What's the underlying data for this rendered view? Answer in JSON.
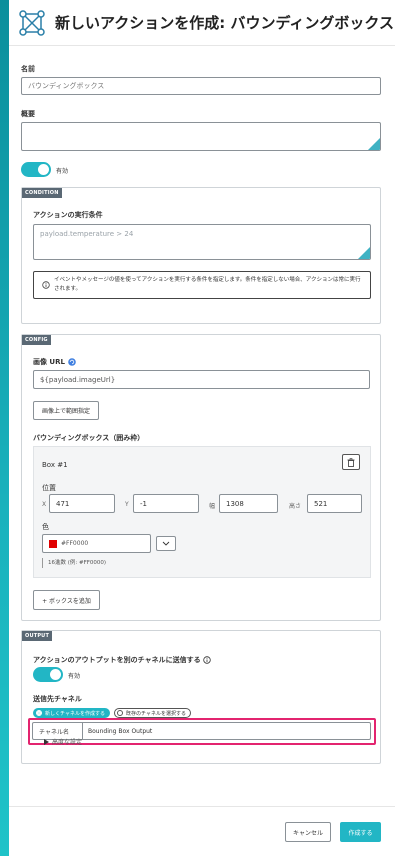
{
  "header": {
    "title": "新しいアクションを作成: バウンディングボックス",
    "icon": "bounding-box-icon"
  },
  "form": {
    "name_label": "名前",
    "name_value": "バウンディングボックス",
    "summary_label": "概要",
    "summary_value": "",
    "enabled_label": "有効",
    "enabled": true
  },
  "condition": {
    "tag": "CONDITION",
    "label": "アクションの実行条件",
    "placeholder": "payload.temperature > 24",
    "info_text": "イベントやメッセージの値を使ってアクションを実行する条件を指定します。条件を指定しない場合、アクションは常に実行されます。"
  },
  "config": {
    "tag": "CONFIG",
    "image_url_label": "画像 URL",
    "image_url_value": "${payload.imageUrl}",
    "select_area_button": "画像上で範囲指定",
    "bbox_label": "バウンディングボックス（囲み枠）",
    "box": {
      "title": "Box #1",
      "position_label": "位置",
      "x_label": "X",
      "x_value": "471",
      "y_label": "Y",
      "y_value": "-1",
      "w_label": "幅",
      "w_value": "1308",
      "h_label": "高さ",
      "h_value": "521",
      "color_label": "色",
      "color_value": "#FF0000",
      "color_swatch": "#E00000",
      "color_hint": "16進数 (例: #FF0000)"
    },
    "add_box_button": "+ ボックスを追加"
  },
  "output": {
    "tag": "OUTPUT",
    "send_label": "アクションのアウトプットを別のチャネルに送信する",
    "enabled_label": "有効",
    "enabled": true,
    "channel_label": "送信先チャネル",
    "option_new": "新しくチャネルを作成する",
    "option_existing": "既存のチャネルを選択する",
    "channel_name_label": "チャネル名",
    "channel_name_value": "Bounding Box Output",
    "advanced_label": "高度な設定"
  },
  "footer": {
    "cancel": "キャンセル",
    "create": "作成する"
  },
  "colors": {
    "accent": "#22B6C5",
    "highlight": "#E3246F"
  }
}
